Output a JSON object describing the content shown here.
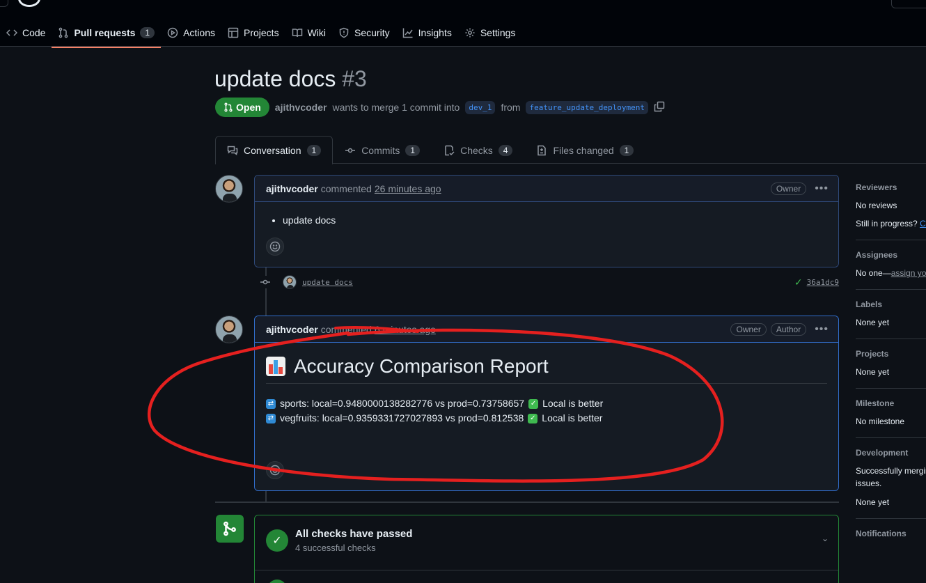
{
  "nav": {
    "items": [
      {
        "label": "Code",
        "icon": "code-icon"
      },
      {
        "label": "Pull requests",
        "icon": "pull-request-icon",
        "count": "1"
      },
      {
        "label": "Actions",
        "icon": "play-icon"
      },
      {
        "label": "Projects",
        "icon": "table-icon"
      },
      {
        "label": "Wiki",
        "icon": "book-icon"
      },
      {
        "label": "Security",
        "icon": "shield-icon"
      },
      {
        "label": "Insights",
        "icon": "graph-icon"
      },
      {
        "label": "Settings",
        "icon": "gear-icon"
      }
    ]
  },
  "pr": {
    "title": "update docs",
    "number": "#3",
    "state": "Open",
    "author": "ajithvcoder",
    "merge_text": "wants to merge 1 commit into",
    "base_branch": "dev_1",
    "from_text": "from",
    "head_branch": "feature_update_deployment"
  },
  "tabs": [
    {
      "label": "Conversation",
      "count": "1"
    },
    {
      "label": "Commits",
      "count": "1"
    },
    {
      "label": "Checks",
      "count": "4"
    },
    {
      "label": "Files changed",
      "count": "1"
    }
  ],
  "comment1": {
    "author": "ajithvcoder",
    "action": "commented",
    "time": "26 minutes ago",
    "role": "Owner",
    "body_item": "update docs"
  },
  "commit": {
    "message": "update docs",
    "sha": "36a1dc9",
    "status_color": "#3fb950"
  },
  "comment2": {
    "author": "ajithvcoder",
    "action": "commented",
    "time": "6 minutes ago",
    "role_owner": "Owner",
    "role_author": "Author",
    "report_title": "Accuracy Comparison Report",
    "lines": [
      {
        "text": "sports: local=0.9480000138282776 vs prod=0.73758657",
        "verdict": "Local is better"
      },
      {
        "text": "vegfruits: local=0.9359331727027893 vs prod=0.812538",
        "verdict": "Local is better"
      }
    ]
  },
  "checks": {
    "title": "All checks have passed",
    "subtitle": "4 successful checks"
  },
  "sidebar": {
    "reviewers_head": "Reviewers",
    "reviewers_value": "No reviews",
    "reviewers_progress": "Still in progress?",
    "reviewers_link": "Co",
    "assignees_head": "Assignees",
    "assignees_value": "No one—",
    "assignees_link": "assign yo",
    "labels_head": "Labels",
    "labels_value": "None yet",
    "projects_head": "Projects",
    "projects_value": "None yet",
    "milestone_head": "Milestone",
    "milestone_value": "No milestone",
    "development_head": "Development",
    "development_text1": "Successfully mergin",
    "development_text2": "issues.",
    "development_value": "None yet",
    "notifications_head": "Notifications"
  },
  "colors": {
    "accent": "#4493f8",
    "success": "#238636",
    "annotation": "#e5201f",
    "tab_underline": "#f78166"
  }
}
